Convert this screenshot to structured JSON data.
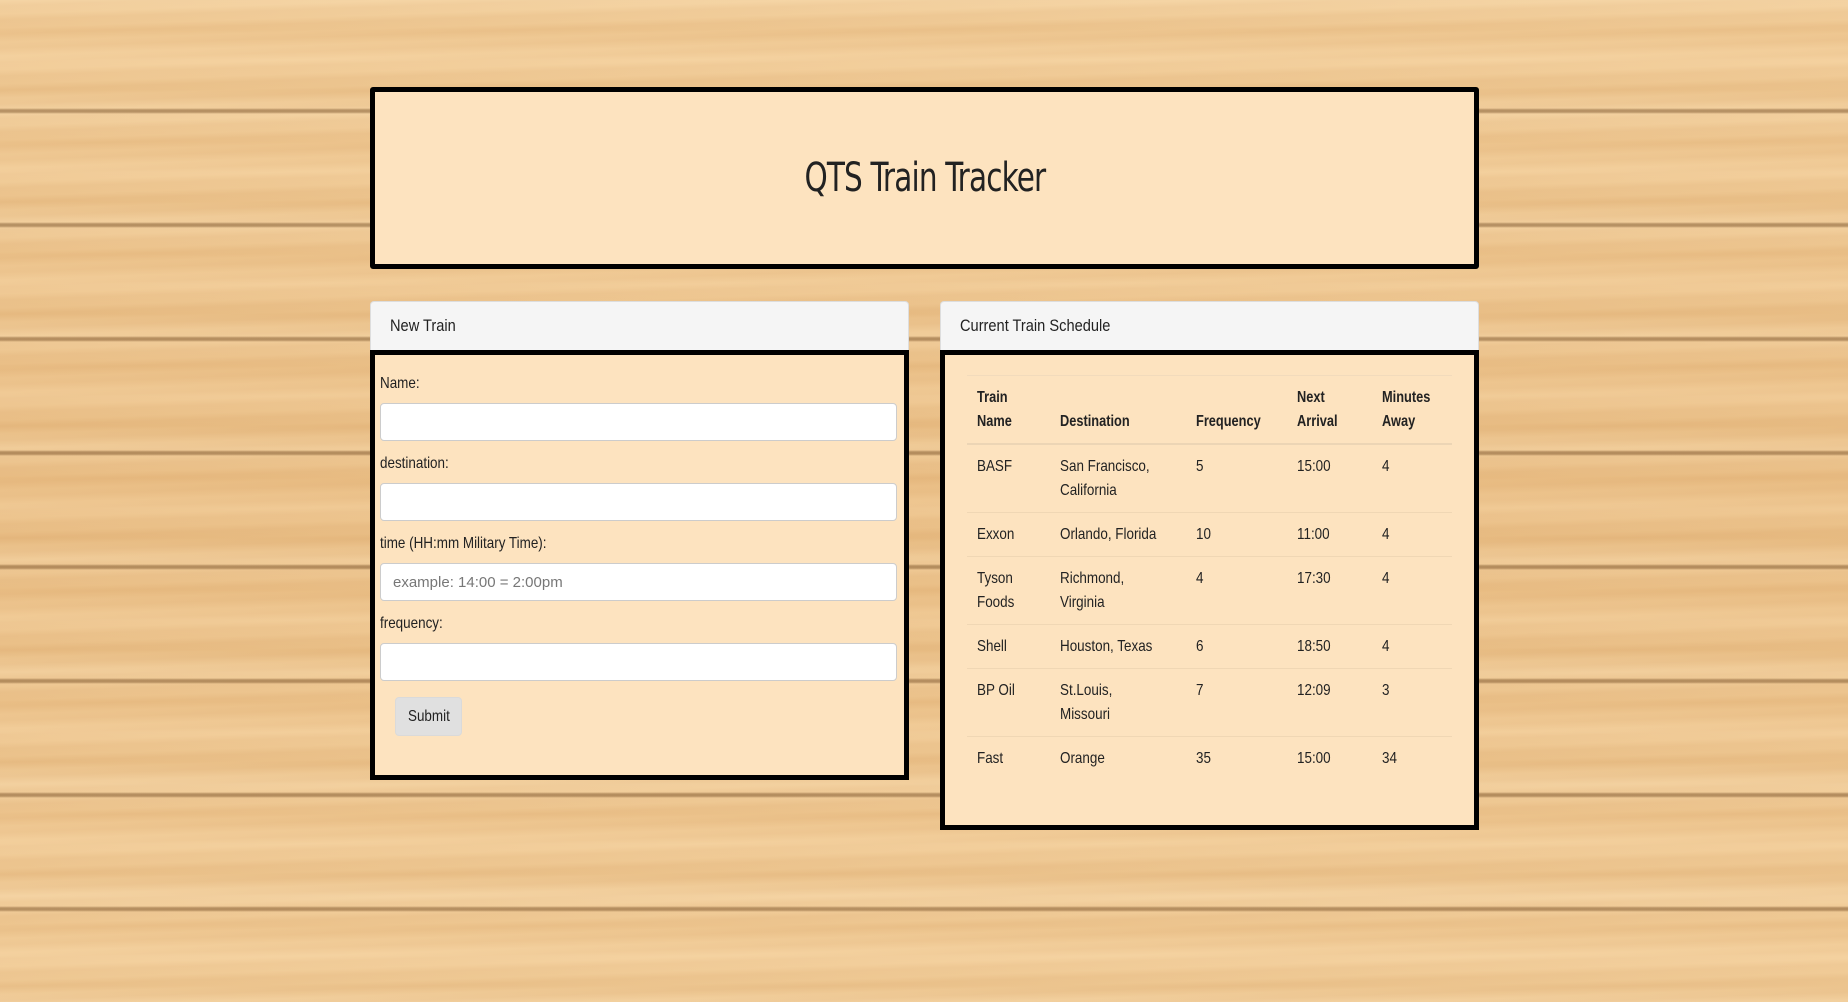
{
  "header": {
    "title": "QTS Train Tracker"
  },
  "new_train_panel": {
    "heading": "New Train",
    "fields": {
      "name": {
        "label": "Name:",
        "value": "",
        "placeholder": ""
      },
      "destination": {
        "label": "destination:",
        "value": "",
        "placeholder": ""
      },
      "time": {
        "label": "time (HH:mm Military Time):",
        "value": "",
        "placeholder": "example: 14:00 = 2:00pm"
      },
      "frequency": {
        "label": "frequency:",
        "value": "",
        "placeholder": ""
      }
    },
    "submit_label": "Submit"
  },
  "schedule_panel": {
    "heading": "Current Train Schedule",
    "columns": [
      "Train Name",
      "Destination",
      "Frequency",
      "Next Arrival",
      "Minutes Away"
    ],
    "rows": [
      [
        "BASF",
        "San Francisco, California",
        "5",
        "15:00",
        "4"
      ],
      [
        "Exxon",
        "Orlando, Florida",
        "10",
        "11:00",
        "4"
      ],
      [
        "Tyson Foods",
        "Richmond, Virginia",
        "4",
        "17:30",
        "4"
      ],
      [
        "Shell",
        "Houston, Texas",
        "6",
        "18:50",
        "4"
      ],
      [
        "BP Oil",
        "St.Louis, Missouri",
        "7",
        "12:09",
        "3"
      ],
      [
        "Fast",
        "Orange",
        "35",
        "15:00",
        "34"
      ]
    ]
  }
}
